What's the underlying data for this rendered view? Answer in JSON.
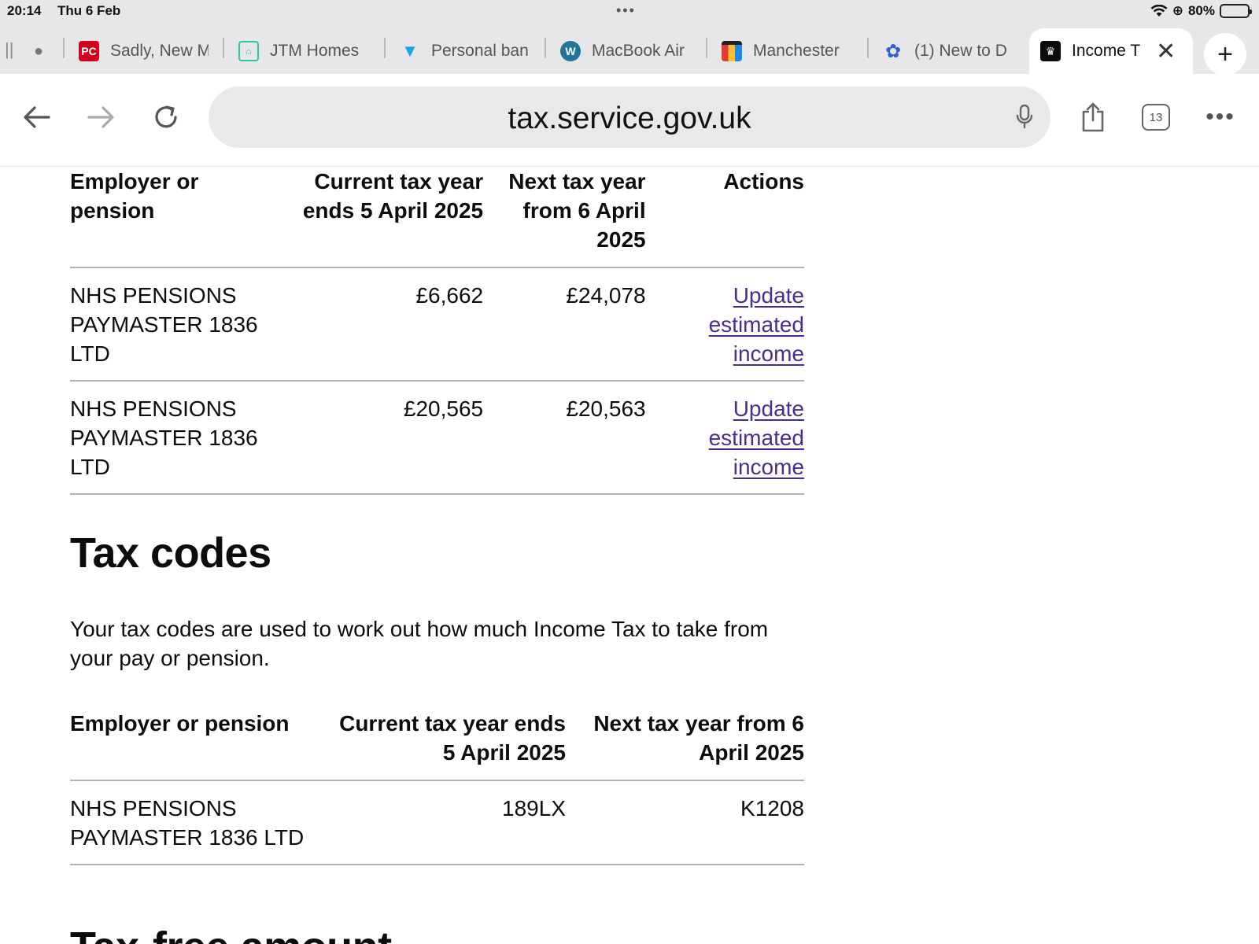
{
  "status_bar": {
    "time": "20:14",
    "date": "Thu 6 Feb",
    "battery": "80%",
    "battery_level": 0.8
  },
  "tabs": [
    {
      "label": "Sadly, New M",
      "icon": "pc-favicon",
      "color": "#d0021b"
    },
    {
      "label": "JTM Homes",
      "icon": "home-favicon",
      "color": "#2bc6a4"
    },
    {
      "label": "Personal ban",
      "icon": "barclays-favicon",
      "color": "#1aa3e8"
    },
    {
      "label": "MacBook Air",
      "icon": "wordpress-favicon",
      "color": "#21759b"
    },
    {
      "label": "Manchester",
      "icon": "manchester-favicon",
      "color": "#a0522d"
    },
    {
      "label": "(1) New to D",
      "icon": "flower-favicon",
      "color": "#2f5fd6"
    },
    {
      "label": "Income T",
      "icon": "crown-favicon",
      "color": "#0b0c0c",
      "active": true
    }
  ],
  "toolbar": {
    "url": "tax.service.gov.uk",
    "tab_count": "13"
  },
  "income_table": {
    "headers": [
      "Employer or pension",
      "Current tax year ends 5 April 2025",
      "Next tax year from 6 April 2025",
      "Actions"
    ],
    "rows": [
      {
        "employer": "NHS PENSIONS PAYMASTER 1836 LTD",
        "current": "£6,662",
        "next": "£24,078",
        "action": "Update estimated income"
      },
      {
        "employer": "NHS PENSIONS PAYMASTER 1836 LTD",
        "current": "£20,565",
        "next": "£20,563",
        "action": "Update estimated income"
      }
    ]
  },
  "tax_codes": {
    "title": "Tax codes",
    "description": "Your tax codes are used to work out how much Income Tax to take from your pay or pension.",
    "headers": [
      "Employer or pension",
      "Current tax year ends 5 April 2025",
      "Next tax year from 6 April 2025"
    ],
    "rows": [
      {
        "employer": "NHS PENSIONS PAYMASTER 1836 LTD",
        "current": "189LX",
        "next": "K1208"
      }
    ]
  },
  "tax_free": {
    "title": "Tax-free amount"
  }
}
